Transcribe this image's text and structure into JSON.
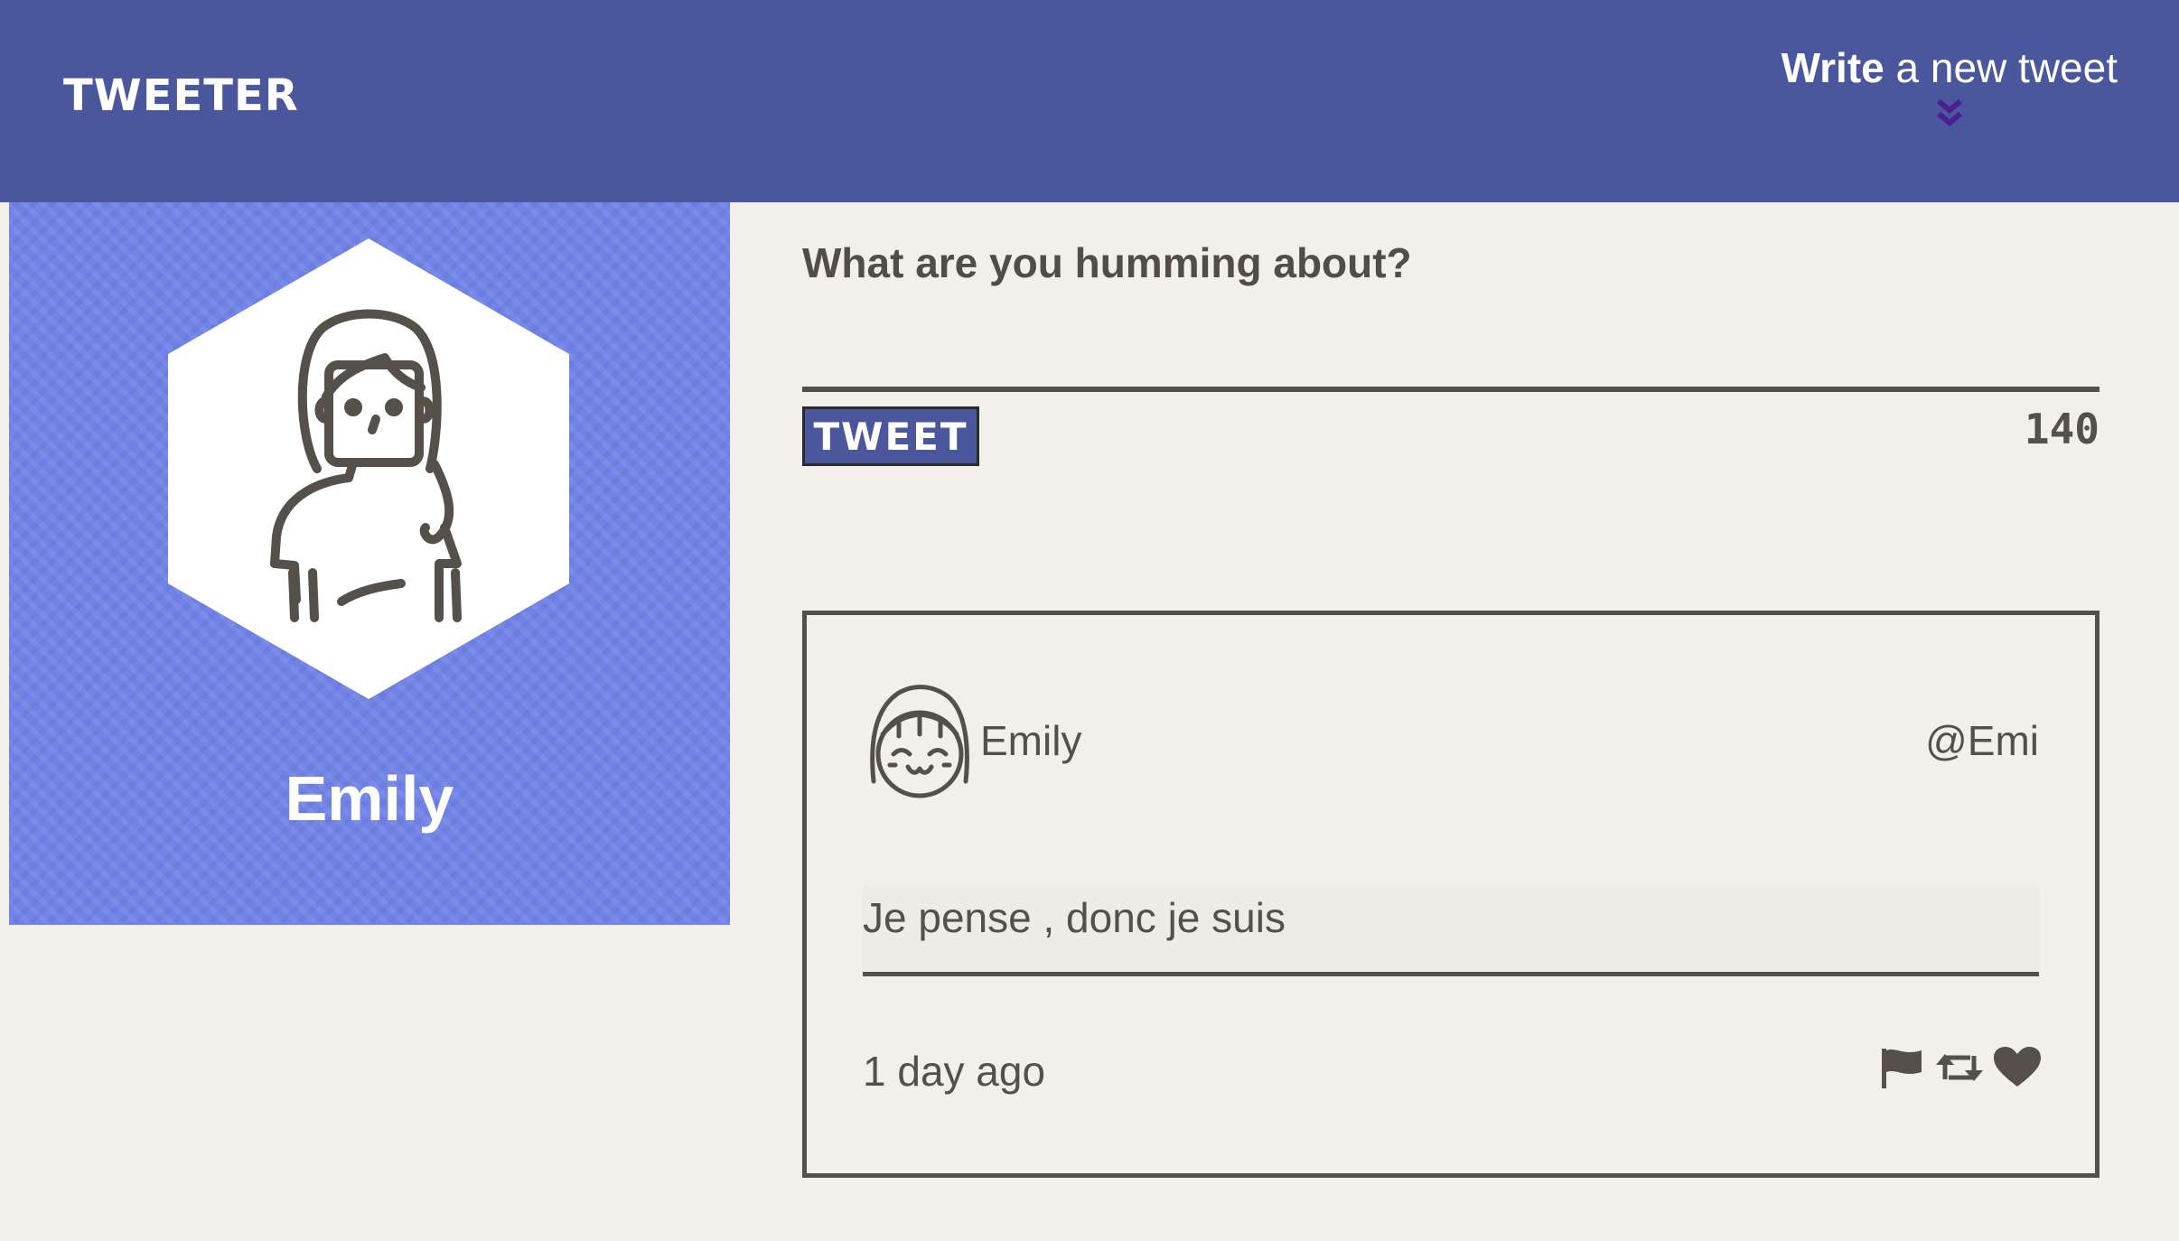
{
  "header": {
    "brand": "TWEETER",
    "compose_toggle_bold": "Write",
    "compose_toggle_rest": " a new tweet",
    "background_color": "#4a579c"
  },
  "profile": {
    "name": "Emily",
    "background_color": "#7183e6",
    "avatar_icon": "woman-avatar-icon"
  },
  "compose": {
    "label": "What are you humming about?",
    "text_value": "",
    "button_label": "TWEET",
    "char_counter": "140"
  },
  "tweets": [
    {
      "display_name": "Emily",
      "handle": "@Emi",
      "text": "Je pense , donc je suis",
      "time": "1 day ago",
      "avatar_icon": "smiling-girl-avatar-icon",
      "actions": [
        "flag-icon",
        "retweet-icon",
        "heart-icon"
      ]
    }
  ]
}
